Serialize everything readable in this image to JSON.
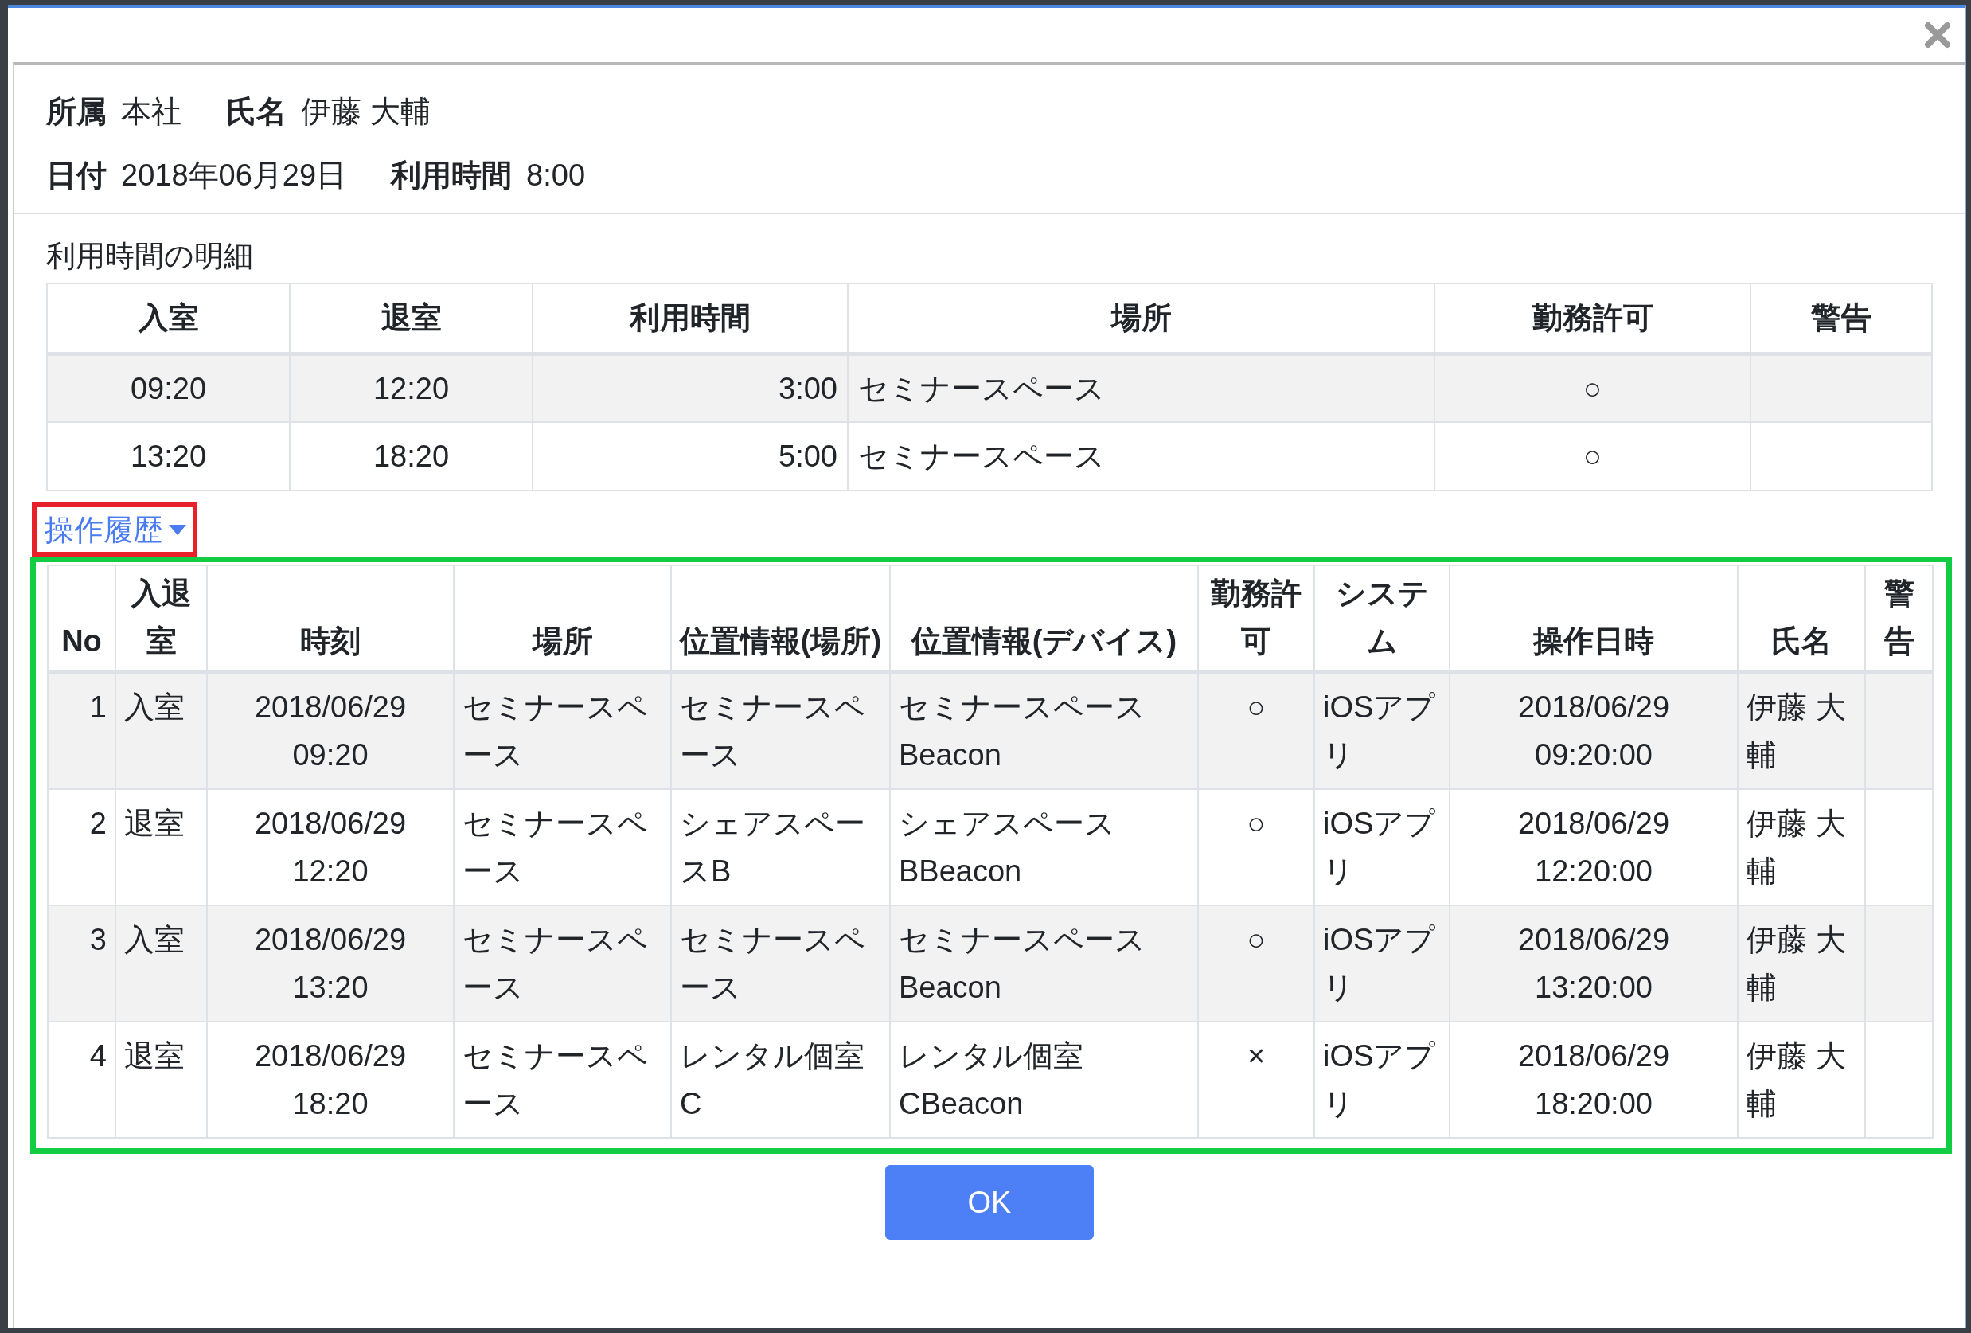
{
  "info_rows": [
    [
      {
        "label": "所属",
        "value": "本社"
      },
      {
        "label": "氏名",
        "value": "伊藤 大輔"
      }
    ],
    [
      {
        "label": "日付",
        "value": "2018年06月29日"
      },
      {
        "label": "利用時間",
        "value": "8:00"
      }
    ]
  ],
  "detail": {
    "title": "利用時間の明細",
    "columns": [
      "入室",
      "退室",
      "利用時間",
      "場所",
      "勤務許可",
      "警告"
    ],
    "rows": [
      [
        "09:20",
        "12:20",
        "3:00",
        "セミナースペース",
        "○",
        ""
      ],
      [
        "13:20",
        "18:20",
        "5:00",
        "セミナースペース",
        "○",
        ""
      ]
    ]
  },
  "history": {
    "toggle": "操作履歴",
    "expanded": true,
    "columns": [
      "No",
      "入退室",
      "時刻",
      "場所",
      "位置情報(場所)",
      "位置情報(デバイス)",
      "勤務許可",
      "システム",
      "操作日時",
      "氏名",
      "警告"
    ],
    "rows": [
      [
        "1",
        "入室",
        "2018/06/29 09:20",
        "セミナースペース",
        "セミナースペース",
        "セミナースペースBeacon",
        "○",
        "iOSアプリ",
        "2018/06/29 09:20:00",
        "伊藤 大輔",
        ""
      ],
      [
        "2",
        "退室",
        "2018/06/29 12:20",
        "セミナースペース",
        "シェアスペースB",
        "シェアスペースBBeacon",
        "○",
        "iOSアプリ",
        "2018/06/29 12:20:00",
        "伊藤 大輔",
        ""
      ],
      [
        "3",
        "入室",
        "2018/06/29 13:20",
        "セミナースペース",
        "セミナースペース",
        "セミナースペースBeacon",
        "○",
        "iOSアプリ",
        "2018/06/29 13:20:00",
        "伊藤 大輔",
        ""
      ],
      [
        "4",
        "退室",
        "2018/06/29 18:20",
        "セミナースペース",
        "レンタル個室C",
        "レンタル個室CBeacon",
        "×",
        "iOSアプリ",
        "2018/06/29 18:20:00",
        "伊藤 大輔",
        ""
      ]
    ]
  },
  "ok_button": "OK"
}
